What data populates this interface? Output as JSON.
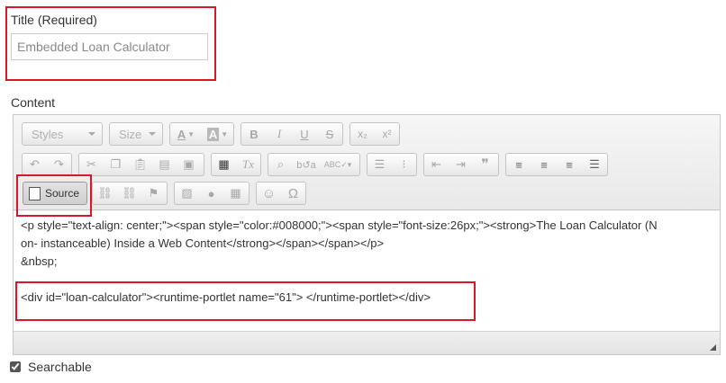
{
  "title_field": {
    "label": "Title (Required)",
    "value": "Embedded Loan Calculator"
  },
  "content": {
    "label": "Content"
  },
  "toolbar": {
    "styles_combo": "Styles",
    "size_combo": "Size",
    "source_label": "Source",
    "text_color_glyph": "A",
    "bg_color_glyph": "A",
    "bold_glyph": "B",
    "italic_glyph": "I",
    "underline_glyph": "U",
    "strike_glyph": "S",
    "subscript_glyph": "x₂",
    "superscript_glyph": "x²",
    "remove_format_glyph": "Tx",
    "blockquote_glyph": "❞",
    "smiley_glyph": "☺",
    "omega_glyph": "Ω"
  },
  "source_code": {
    "line1": "<p style=\"text-align: center;\"><span style=\"color:#008000;\"><span style=\"font-size:26px;\"><strong>The Loan Calculator (N",
    "line2": "on- instanceable) Inside a Web Content</strong></span></span></p>",
    "line3": "&nbsp;",
    "line4": "<div id=\"loan-calculator\"><runtime-portlet name=\"61\"> </runtime-portlet></div>"
  },
  "searchable": {
    "label": "Searchable",
    "checked": true
  },
  "colors": {
    "highlight_box": "#d9172b",
    "toolbar_bg": "#eeeeee"
  }
}
